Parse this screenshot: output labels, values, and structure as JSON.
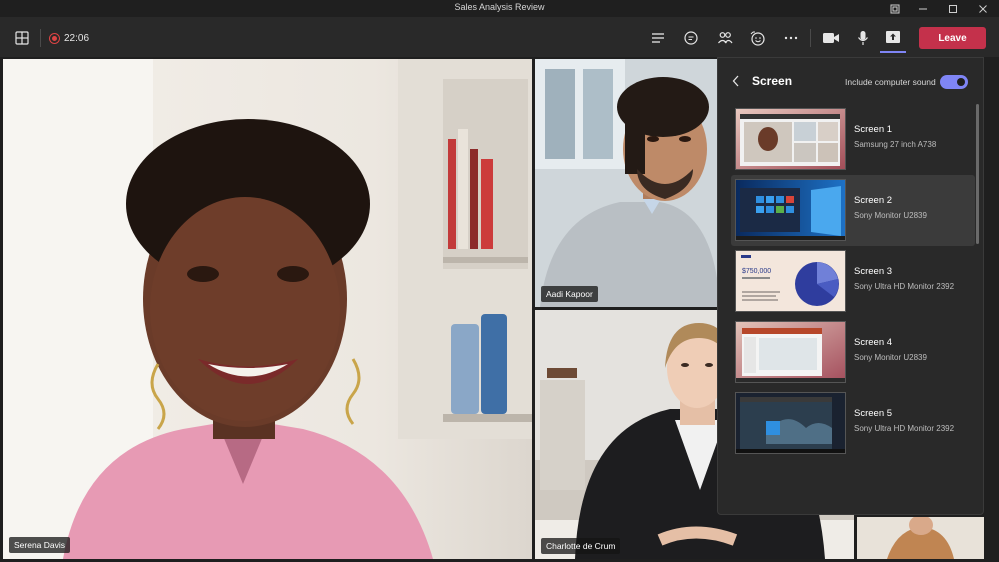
{
  "window": {
    "title": "Sales Analysis Review"
  },
  "toolbar": {
    "timer": "22:06",
    "leave_label": "Leave"
  },
  "participants": [
    {
      "name": "Serena Davis"
    },
    {
      "name": "Aadi Kapoor"
    },
    {
      "name": "Charlotte de Crum"
    }
  ],
  "share_panel": {
    "title": "Screen",
    "sound_label": "Include computer sound",
    "sound_enabled": true,
    "screens": [
      {
        "name": "Screen 1",
        "monitor": "Samsung 27 inch A738",
        "selected": false
      },
      {
        "name": "Screen 2",
        "monitor": "Sony Monitor U2839",
        "selected": true
      },
      {
        "name": "Screen 3",
        "monitor": "Sony Ultra HD Monitor 2392",
        "selected": false,
        "thumb_text": "$750,000"
      },
      {
        "name": "Screen 4",
        "monitor": "Sony Monitor U2839",
        "selected": false
      },
      {
        "name": "Screen 5",
        "monitor": "Sony Ultra HD Monitor 2392",
        "selected": false
      }
    ]
  },
  "colors": {
    "accent": "#7f85f5",
    "leave": "#c4314b",
    "recording": "#dd4444"
  }
}
